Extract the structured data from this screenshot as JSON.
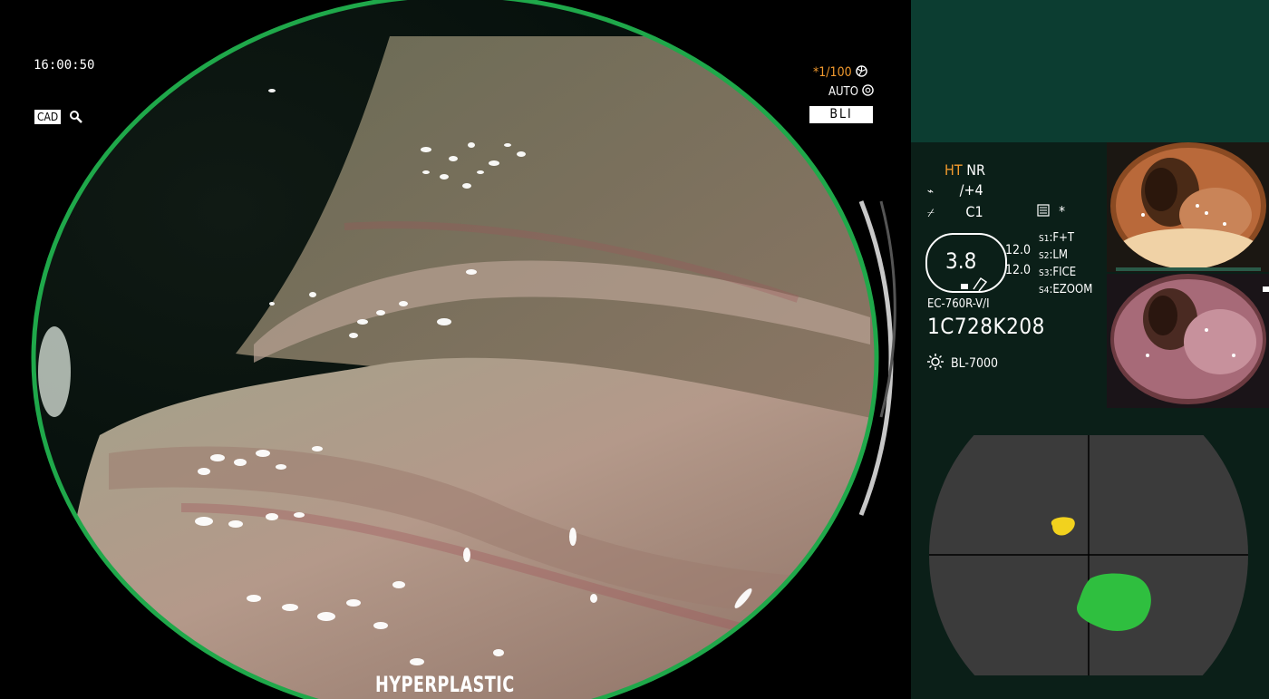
{
  "main_view": {
    "time": "16:00:50",
    "cad_label": "CAD",
    "shutter": "*1/100",
    "iris": "AUTO",
    "mode": "BLI",
    "diagnosis": "HYPERPLASTIC"
  },
  "info_panel": {
    "ht_label": "HT",
    "nr_label": "NR",
    "enhance": "/+4",
    "color_mode": "C1",
    "star": "*",
    "zoom_value": "3.8",
    "zoom_readings": [
      "12.0",
      "12.0"
    ],
    "switches": [
      {
        "key": "S1",
        "value": "F+T"
      },
      {
        "key": "S2",
        "value": "LM"
      },
      {
        "key": "S3",
        "value": "FICE"
      },
      {
        "key": "S4",
        "value": "EZOOM"
      }
    ],
    "scope_model": "EC-760R-V/I",
    "serial": "1C728K208",
    "light_source": "BL-7000"
  },
  "colors": {
    "ring": "#1fa84a",
    "panel_bg": "#0b1f18",
    "panel_top": "#0c3d31",
    "ht_orange": "#f29a2e",
    "map_bg": "#3b3b3b",
    "blob_yellow": "#f2d21e",
    "blob_green": "#2fbf3f"
  },
  "icons": [
    "magnifier-icon",
    "shutter-icon",
    "iris-icon",
    "enhance-icon",
    "color-icon",
    "grid-icon",
    "light-icon"
  ]
}
